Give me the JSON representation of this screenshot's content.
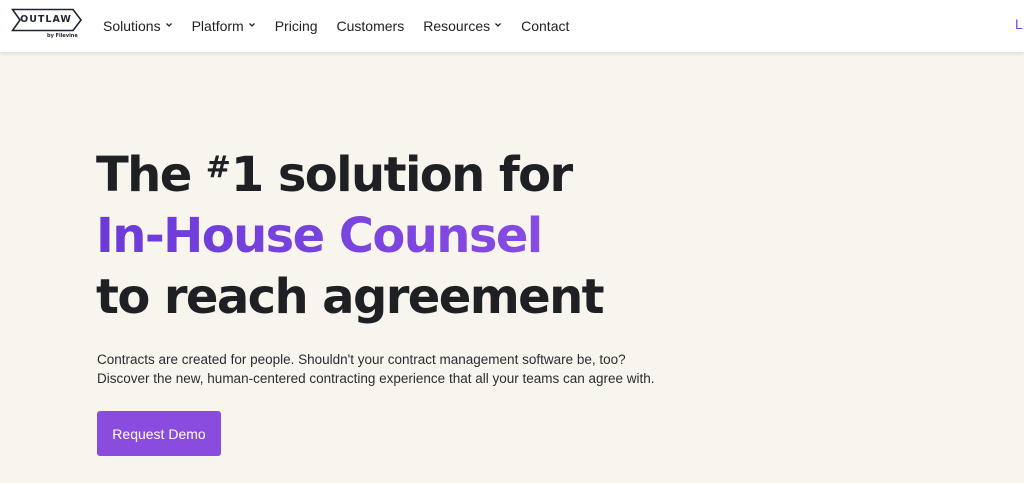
{
  "header": {
    "logo": {
      "word": "OUTLAW",
      "sub": "by Filevine"
    },
    "nav": [
      {
        "label": "Solutions",
        "dropdown": true
      },
      {
        "label": "Platform",
        "dropdown": true
      },
      {
        "label": "Pricing",
        "dropdown": false
      },
      {
        "label": "Customers",
        "dropdown": false
      },
      {
        "label": "Resources",
        "dropdown": true
      },
      {
        "label": "Contact",
        "dropdown": false
      }
    ],
    "login_partial": "L"
  },
  "hero": {
    "line1_before": "The ",
    "line1_sup": "#",
    "line1_after": "1 solution for",
    "line2_accent": "In-House Counsel",
    "line3": "to reach agreement",
    "desc_line1": "Contracts are created for people. Shouldn't your contract management software be, too?",
    "desc_line2": "Discover the new, human-centered contracting experience that all your teams can agree with.",
    "cta_label": "Request Demo"
  },
  "colors": {
    "accent": "#7b3fe4",
    "cta": "#8a4cde",
    "background": "#f8f5ef",
    "text": "#1f2023"
  },
  "icons": {
    "dropdown": "chevron-down-icon",
    "logo": "outlaw-logo-icon"
  }
}
